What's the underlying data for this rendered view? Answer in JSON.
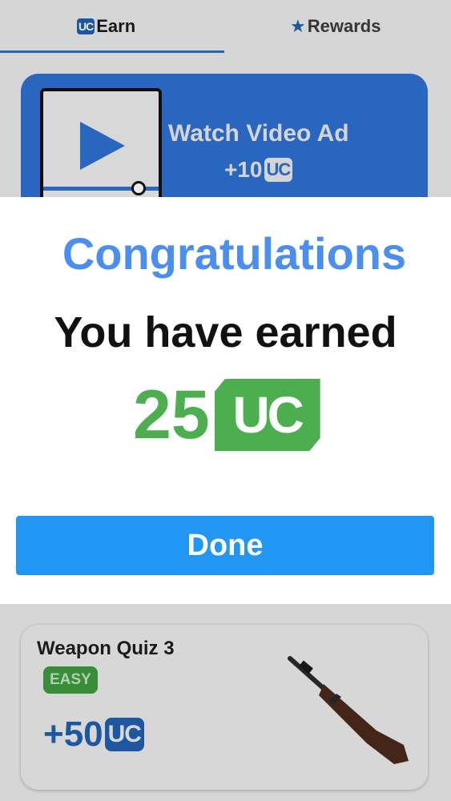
{
  "tabs": {
    "earn": {
      "logo": "UC",
      "label": "Earn"
    },
    "rewards": {
      "icon": "star-icon",
      "label": "Rewards"
    }
  },
  "ad_card": {
    "title": "Watch Video Ad",
    "reward": "+10",
    "currency": "UC"
  },
  "dialog": {
    "title": "Congratulations",
    "subtitle": "You have earned",
    "amount": "25",
    "currency": "UC",
    "done_label": "Done"
  },
  "quiz_card": {
    "title": "Weapon Quiz 3",
    "difficulty": "EASY",
    "reward": "+50",
    "currency": "UC"
  },
  "colors": {
    "accent_blue": "#2196f3",
    "title_blue": "#4a8ef0",
    "reward_green": "#4cae4f",
    "card_blue": "#2d6fd1"
  }
}
